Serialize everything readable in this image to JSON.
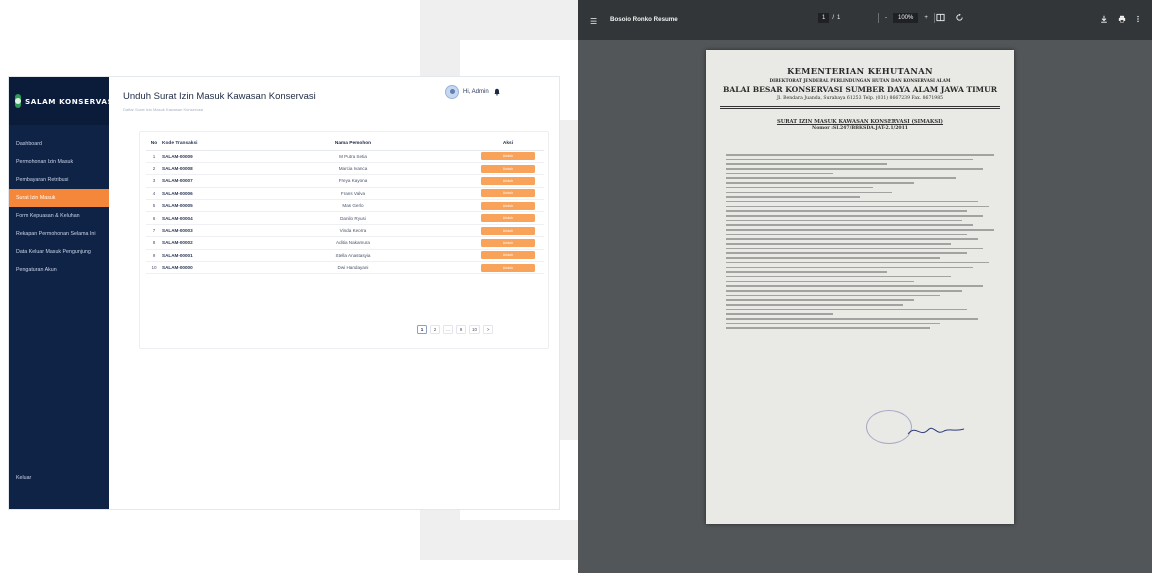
{
  "app": {
    "brand": "SALAM KONSERVASI",
    "menu": [
      "Dashboard",
      "Permohonan Izin Masuk",
      "Pembayaran Retribusi",
      "Surat Izin Masuk",
      "Form Kepuasan & Keluhan",
      "Rekapan Permohonan Selama Ini",
      "Data Keluar Masuk Pengunjung",
      "Pengaturan Akun"
    ],
    "active_menu_index": 3,
    "logout": "Keluar",
    "page_title": "Unduh Surat Izin Masuk Kawasan Konservasi",
    "subtitle": "Daftar Surat Izin Masuk Kawasan Konservasi",
    "user_greeting": "Hi, Admin",
    "table": {
      "headers": [
        "No",
        "Kode Transaksi",
        "Nama Pemohon",
        "Aksi"
      ],
      "rows": [
        [
          "1",
          "SALAM-00009",
          "M Putra Setia",
          "Unduh"
        ],
        [
          "2",
          "SALAM-00008",
          "Marcia Ivanca",
          "Unduh"
        ],
        [
          "3",
          "SALAM-00007",
          "Freya Kayona",
          "Unduh"
        ],
        [
          "4",
          "SALAM-00006",
          "Frans Valva",
          "Unduh"
        ],
        [
          "5",
          "SALAM-00005",
          "Mas Gerlo",
          "Unduh"
        ],
        [
          "6",
          "SALAM-00004",
          "Danilo Ryusi",
          "Unduh"
        ],
        [
          "7",
          "SALAM-00003",
          "Vinda Keorra",
          "Unduh"
        ],
        [
          "8",
          "SALAM-00002",
          "Aditia Nakamura",
          "Unduh"
        ],
        [
          "9",
          "SALAM-00001",
          "Stella Anastasyia",
          "Unduh"
        ],
        [
          "10",
          "SALAM-00000",
          "Dwi Handayani",
          "Unduh"
        ]
      ]
    },
    "pagination": [
      "1",
      "2",
      "...",
      "9",
      "10",
      ">"
    ],
    "current_page": "1"
  },
  "viewer": {
    "doc_title": "Bosoio Ronko Resume",
    "page_current": "1",
    "page_total": "1",
    "zoom": "100%",
    "zoom_minus": "-",
    "zoom_plus": "+",
    "icons": [
      "menu-icon",
      "fit-page-icon",
      "rotate-icon",
      "download-icon",
      "print-icon",
      "more-icon"
    ]
  },
  "document": {
    "h1": "KEMENTERIAN KEHUTANAN",
    "h2": "DIREKTORAT JENDERAL PERLINDUNGAN HUTAN DAN KONSERVASI ALAM",
    "h3": "BALAI BESAR KONSERVASI SUMBER DAYA ALAM JAWA TIMUR",
    "h4": "Jl. Bendara Juanda, Surabaya 61253 Telp. (031) 8667239 Fax. 8671985",
    "title": "SURAT IZIN MASUK KAWASAN KONSERVASI (SIMAKSI)",
    "number": "Nomor :SI.247/BBKSDA.JAT-2.1/2011"
  },
  "colors": {
    "sidebar": "#0f2347",
    "accent": "#f5873a",
    "button": "#f8a25a",
    "viewer_bg": "#525659",
    "viewer_bar": "#323639"
  }
}
